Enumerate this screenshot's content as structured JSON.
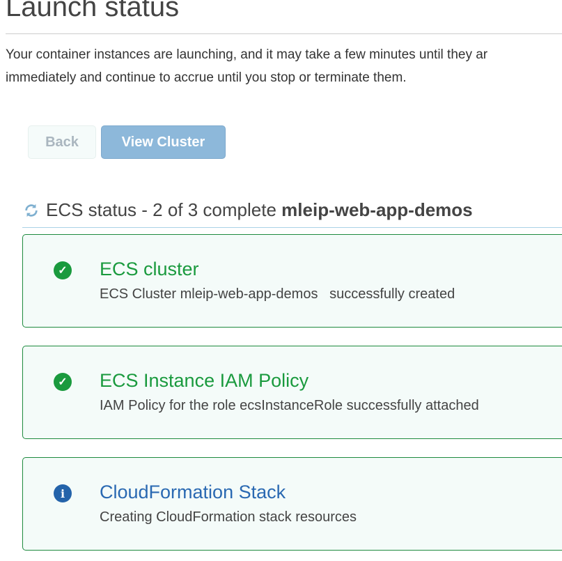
{
  "page": {
    "title": "Launch status",
    "intro_line1": "Your container instances are launching, and it may take a few minutes until they ar",
    "intro_line2": "immediately and continue to accrue until you stop or terminate them."
  },
  "buttons": {
    "back": "Back",
    "view_cluster": "View Cluster"
  },
  "status": {
    "text": "ECS status - 2 of 3 complete",
    "cluster": "mleip-web-app-demos"
  },
  "cards": [
    {
      "title": "ECS cluster",
      "desc": "ECS Cluster mleip-web-app-demos   successfully created",
      "icon": "check-circle-icon"
    },
    {
      "title": "ECS Instance IAM Policy",
      "desc": "IAM Policy for the role ecsInstanceRole successfully attached",
      "icon": "check-circle-icon"
    },
    {
      "title": "CloudFormation Stack",
      "desc": "Creating CloudFormation stack resources",
      "icon": "info-circle-icon"
    }
  ]
}
